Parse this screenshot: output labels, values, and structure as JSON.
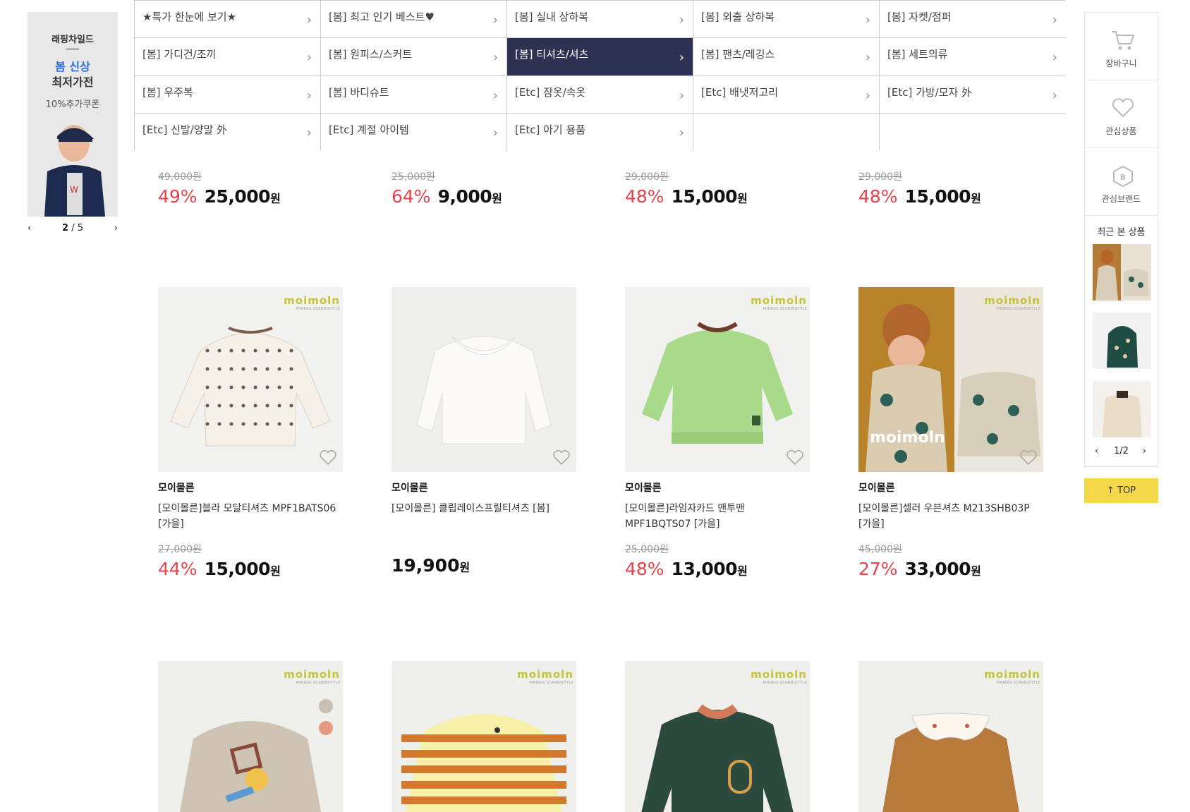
{
  "left_banner": {
    "brand": "래핑차일드",
    "sub": "봄 신상",
    "main": "최저가전",
    "coupon": "10%추가쿠폰",
    "page_current": "2",
    "page_total": "/ 5",
    "prev": "‹",
    "next": "›"
  },
  "categories": [
    {
      "label": "★특가 한눈에 보기★"
    },
    {
      "label": "[봄] 최고 인기 베스트♥"
    },
    {
      "label": "[봄] 실내 상하복"
    },
    {
      "label": "[봄] 외출 상하복"
    },
    {
      "label": "[봄] 자켓/점퍼"
    },
    {
      "label": "[봄] 가디건/조끼"
    },
    {
      "label": "[봄] 원피스/스커트"
    },
    {
      "label": "[봄] 티셔츠/셔츠"
    },
    {
      "label": "[봄] 팬츠/레깅스"
    },
    {
      "label": "[봄] 세트의류"
    },
    {
      "label": "[봄] 우주복"
    },
    {
      "label": "[봄] 바디슈트"
    },
    {
      "label": "[Etc] 잠옷/속옷"
    },
    {
      "label": "[Etc] 배냇저고리"
    },
    {
      "label": "[Etc] 가방/모자 外"
    },
    {
      "label": "[Etc] 신발/양말 外"
    },
    {
      "label": "[Etc] 계절 아이템"
    },
    {
      "label": "[Etc] 아기 용품"
    },
    {
      "label": ""
    },
    {
      "label": ""
    }
  ],
  "active_category": "[봄] 티셔츠/셔츠",
  "row0_prices": [
    {
      "orig": "49,000원",
      "discount": "49%",
      "sale": "25,000",
      "won": "원"
    },
    {
      "orig": "25,000원",
      "discount": "64%",
      "sale": "9,000",
      "won": "원"
    },
    {
      "orig": "29,000원",
      "discount": "48%",
      "sale": "15,000",
      "won": "원"
    },
    {
      "orig": "29,000원",
      "discount": "48%",
      "sale": "15,000",
      "won": "원"
    }
  ],
  "products": [
    {
      "logo": "moimoln",
      "brand": "모이몰른",
      "name": "[모이몰른]블라 모달티셔츠 MPF1BATS06 [가을]",
      "orig": "27,000원",
      "discount": "44%",
      "sale": "15,000",
      "won": "원"
    },
    {
      "logo": "",
      "brand": "모이몰른",
      "name": "[모이몰른] 클립레이스프릴티셔츠 [봄]",
      "price": "19,900",
      "won": "원"
    },
    {
      "logo": "moimoln",
      "brand": "모이몰른",
      "name": "[모이몰른]라임자카드 맨투맨 MPF1BQTS07 [가을]",
      "orig": "25,000원",
      "discount": "48%",
      "sale": "13,000",
      "won": "원"
    },
    {
      "logo": "moimoln",
      "brand": "모이몰른",
      "name": "[모이몰른]셀러 우븐셔츠 M213SHB03P [가을]",
      "orig": "45,000원",
      "discount": "27%",
      "sale": "33,000",
      "won": "원"
    }
  ],
  "row2": [
    {
      "logo": "moimoln"
    },
    {
      "logo": "moimoln"
    },
    {
      "logo": "moimoln"
    },
    {
      "logo": "moimoln"
    }
  ],
  "right_panel": {
    "cart": "장바구니",
    "wish": "관심상품",
    "brand": "관심브랜드",
    "recent_title": "최근 본 상품",
    "page": "1/2",
    "prev": "‹",
    "next": "›",
    "top": "TOP"
  }
}
